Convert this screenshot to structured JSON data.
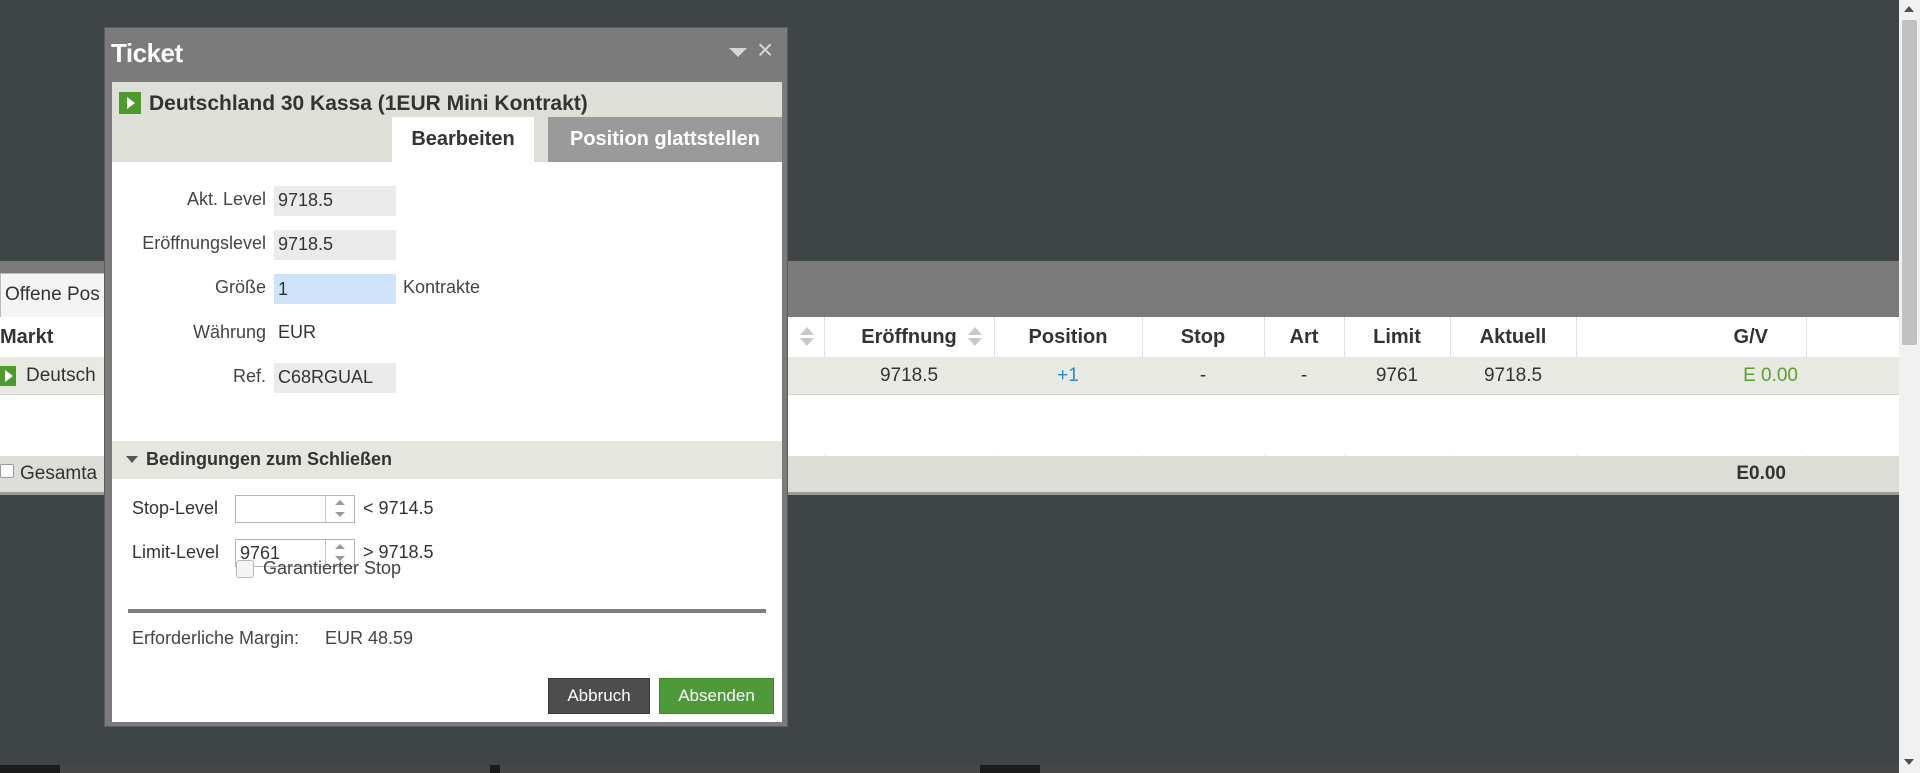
{
  "colors": {
    "background": "#3f4446",
    "accent_green": "#4e9a2e",
    "link_blue": "#2a8ad4",
    "pnl_green": "#5aa02c"
  },
  "background_panel": {
    "tab_label": "Offene Pos",
    "columns": {
      "market": "Markt",
      "opening": "Eröffnung",
      "position": "Position",
      "stop": "Stop",
      "type": "Art",
      "limit": "Limit",
      "current": "Aktuell",
      "pnl": "G/V"
    },
    "row": {
      "market": "Deutsch",
      "opening": "9718.5",
      "position": "+1",
      "stop": "-",
      "type": "-",
      "limit": "9761",
      "current": "9718.5",
      "pnl": "E 0.00"
    },
    "total_label": "Gesamta",
    "total_value": "E0.00"
  },
  "dialog": {
    "title": "Ticket",
    "instrument": "Deutschland 30 Kassa (1EUR Mini Kontrakt)",
    "tabs": [
      "Bearbeiten",
      "Position glattstellen"
    ],
    "fields": {
      "current_level_label": "Akt. Level",
      "current_level": "9718.5",
      "opening_level_label": "Eröffnungslevel",
      "opening_level": "9718.5",
      "size_label": "Größe",
      "size": "1",
      "size_unit": "Kontrakte",
      "currency_label": "Währung",
      "currency": "EUR",
      "ref_label": "Ref.",
      "ref": "C68RGUAL"
    },
    "conditions": {
      "header": "Bedingungen zum Schließen",
      "stop_label": "Stop-Level",
      "stop_value": "",
      "stop_hint": "< 9714.5",
      "limit_label": "Limit-Level",
      "limit_value": "9761",
      "limit_hint": "> 9718.5",
      "guaranteed_stop_label": "Garantierter Stop",
      "guaranteed_stop_checked": false
    },
    "margin_label": "Erforderliche Margin:",
    "margin_value": "EUR 48.59",
    "cancel_label": "Abbruch",
    "submit_label": "Absenden"
  }
}
